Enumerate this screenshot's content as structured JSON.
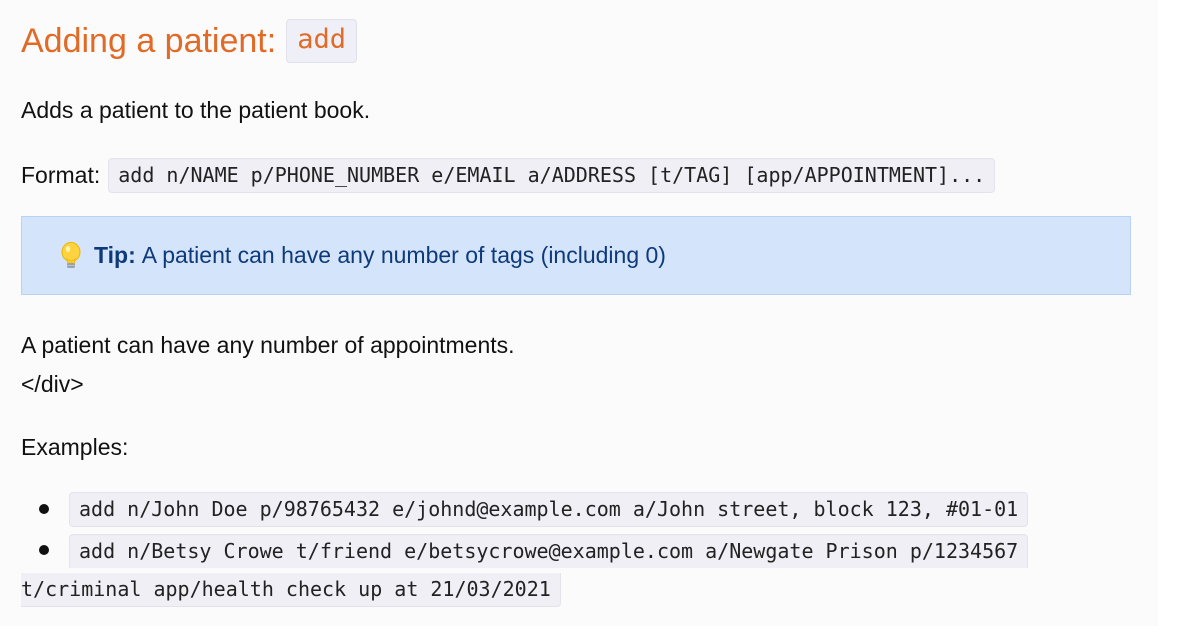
{
  "section": {
    "title": "Adding a patient:",
    "command": "add"
  },
  "intro": "Adds a patient to the patient book.",
  "format": {
    "label": "Format:",
    "syntax": "add n/NAME p/PHONE_NUMBER e/EMAIL a/ADDRESS [t/TAG] [app/APPOINTMENT]..."
  },
  "tip": {
    "icon": "lightbulb-icon",
    "label": "Tip:",
    "text": "A patient can have any number of tags (including 0)"
  },
  "appointments_note": "A patient can have any number of appointments.",
  "stray_tag": "</div>",
  "examples": {
    "label": "Examples:",
    "items": [
      {
        "line1": "add n/John Doe p/98765432 e/johnd@example.com a/John street, block 123, #01-01"
      },
      {
        "line1": "add n/Betsy Crowe t/friend e/betsycrowe@example.com a/Newgate Prison p/1234567",
        "line2": "t/criminal app/health check up at 21/03/2021"
      }
    ]
  },
  "colors": {
    "heading": "#e06a26",
    "tip_background": "#d4e4fa",
    "tip_text": "#0e3a7a",
    "code_background": "#efeff5"
  }
}
